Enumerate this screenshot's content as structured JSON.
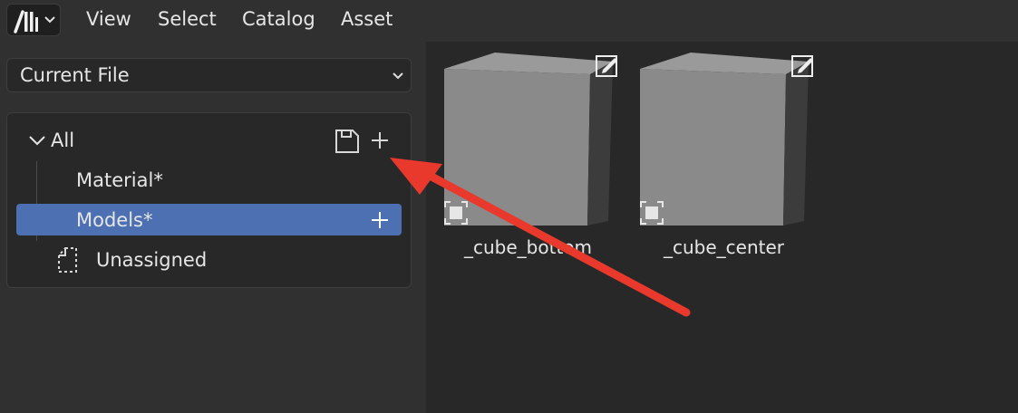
{
  "header": {
    "menus": [
      "View",
      "Select",
      "Catalog",
      "Asset"
    ]
  },
  "sidebar": {
    "library": "Current File",
    "catalogs": {
      "root": "All",
      "children": [
        "Material*",
        "Models*"
      ],
      "unassigned": "Unassigned"
    }
  },
  "browser": {
    "assets": [
      {
        "name": "_cube_bottom"
      },
      {
        "name": "_cube_center"
      }
    ]
  },
  "colors": {
    "selection": "#4d70b3",
    "annotation_arrow": "#e8392c",
    "cube_face": "#8a8a8a"
  },
  "icons": [
    "asset-browser-icon",
    "chevron-down-icon",
    "save-icon",
    "plus-icon",
    "unassigned-icon",
    "edit-icon",
    "object-icon"
  ]
}
